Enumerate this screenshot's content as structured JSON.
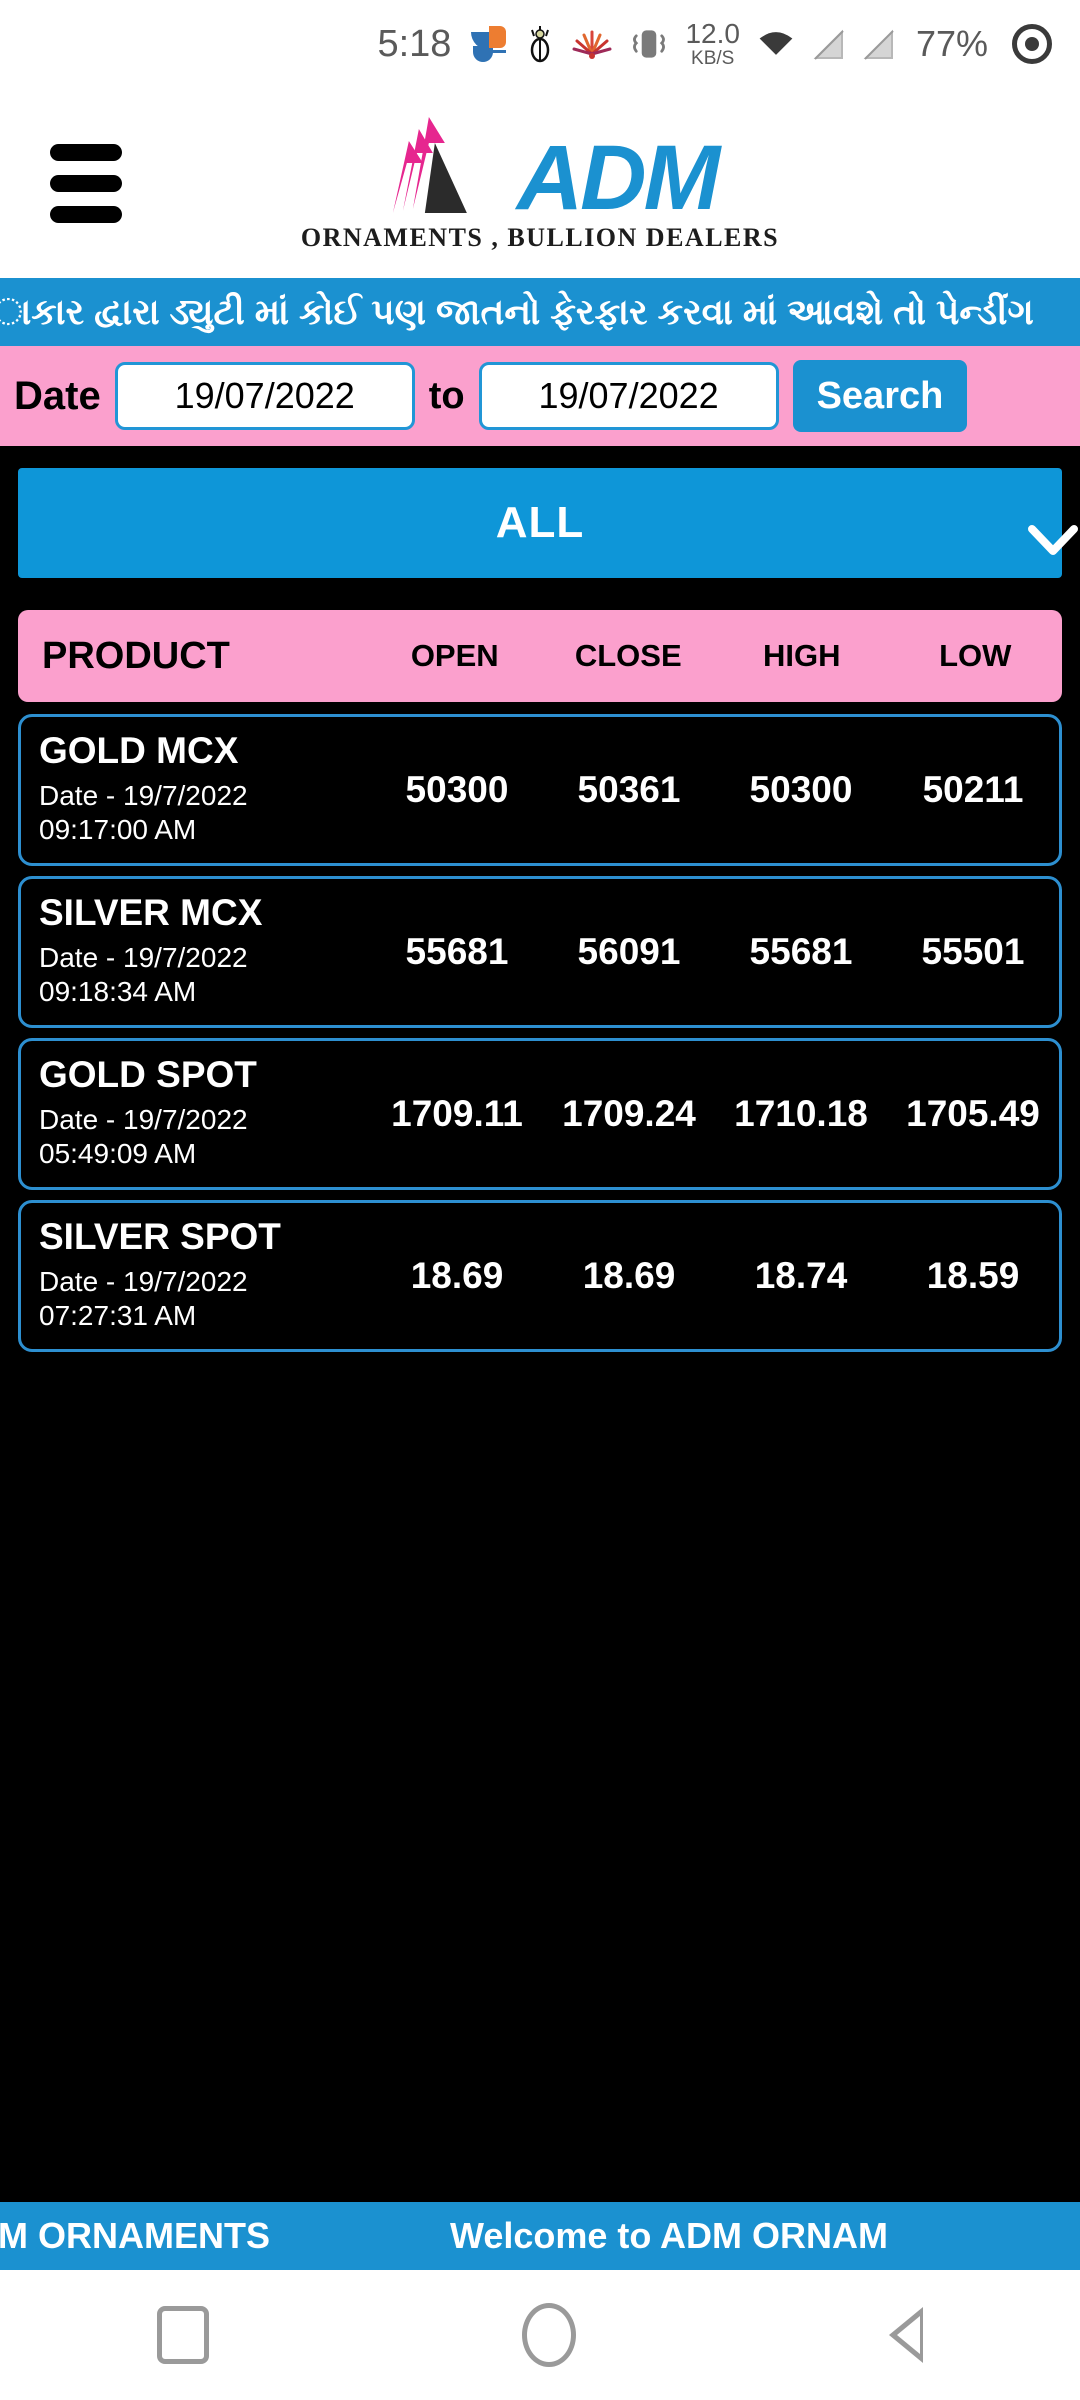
{
  "status_bar": {
    "time": "5:18",
    "network_speed_value": "12.0",
    "network_speed_unit": "KB/S",
    "battery_percent": "77%",
    "icons": [
      "s-app-icon",
      "crown-icon",
      "sunburst-icon",
      "vibrate-icon",
      "wifi-icon",
      "sim-card-icon",
      "sim-card-icon",
      "battery-circle-icon"
    ]
  },
  "header": {
    "menu_icon": "hamburger-menu-icon",
    "logo_text": "ADM",
    "tagline": "ORNAMENTS , BULLION DEALERS"
  },
  "marquee_top": {
    "text": "ાકાર દ્વારા ડ્યુટી માં કોઈ પણ જાતનો ફેરફાર કરવા માં આવશે તો પેન્ડીંગ"
  },
  "date_bar": {
    "label": "Date",
    "from_value": "19/07/2022",
    "to_label": "to",
    "to_value": "19/07/2022",
    "search_label": "Search"
  },
  "filter": {
    "selected": "ALL",
    "chevron": "chevron-down-icon"
  },
  "table": {
    "headers": {
      "product": "PRODUCT",
      "open": "OPEN",
      "close": "CLOSE",
      "high": "HIGH",
      "low": "LOW"
    },
    "rows": [
      {
        "name": "GOLD MCX",
        "date": "Date - 19/7/2022",
        "time": "09:17:00 AM",
        "open": "50300",
        "close": "50361",
        "high": "50300",
        "low": "50211"
      },
      {
        "name": "SILVER MCX",
        "date": "Date - 19/7/2022",
        "time": "09:18:34 AM",
        "open": "55681",
        "close": "56091",
        "high": "55681",
        "low": "55501"
      },
      {
        "name": "GOLD SPOT",
        "date": "Date - 19/7/2022",
        "time": "05:49:09 AM",
        "open": "1709.11",
        "close": "1709.24",
        "high": "1710.18",
        "low": "1705.49"
      },
      {
        "name": "SILVER SPOT",
        "date": "Date - 19/7/2022",
        "time": "07:27:31 AM",
        "open": "18.69",
        "close": "18.69",
        "high": "18.74",
        "low": "18.59"
      }
    ]
  },
  "marquee_bottom": {
    "left_text": ")M ORNAMENTS",
    "right_text": "Welcome to ADM ORNAM"
  },
  "navbar": {
    "recents": "recents-square-icon",
    "home": "home-circle-icon",
    "back": "back-triangle-icon"
  },
  "colors": {
    "brand_blue": "#1b91d0",
    "pink": "#fba0cd",
    "background": "#000000",
    "logo_magenta": "#e6268f"
  }
}
